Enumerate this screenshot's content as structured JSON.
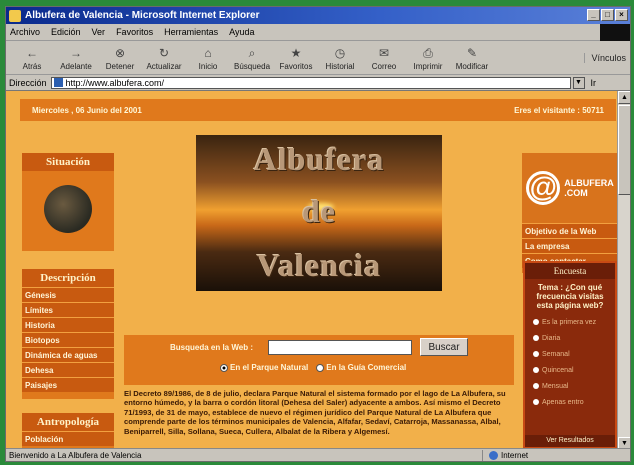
{
  "window": {
    "title": "Albufera de Valencia - Microsoft Internet Explorer",
    "buttons": [
      "_",
      "□",
      "×"
    ]
  },
  "menubar": [
    "Archivo",
    "Edición",
    "Ver",
    "Favoritos",
    "Herramientas",
    "Ayuda"
  ],
  "toolbar": {
    "items": [
      {
        "label": "Atrás",
        "icon": "back-arrow-icon",
        "glyph": "←"
      },
      {
        "label": "Adelante",
        "icon": "forward-arrow-icon",
        "glyph": "→"
      },
      {
        "label": "Detener",
        "icon": "stop-icon",
        "glyph": "⊗"
      },
      {
        "label": "Actualizar",
        "icon": "refresh-icon",
        "glyph": "↻"
      },
      {
        "label": "Inicio",
        "icon": "home-icon",
        "glyph": "⌂"
      },
      {
        "label": "Búsqueda",
        "icon": "search-icon",
        "glyph": "⌕"
      },
      {
        "label": "Favoritos",
        "icon": "favorites-icon",
        "glyph": "★"
      },
      {
        "label": "Historial",
        "icon": "history-icon",
        "glyph": "◷"
      },
      {
        "label": "Correo",
        "icon": "mail-icon",
        "glyph": "✉"
      },
      {
        "label": "Imprimir",
        "icon": "print-icon",
        "glyph": "⎙"
      },
      {
        "label": "Modificar",
        "icon": "edit-icon",
        "glyph": "✎"
      }
    ],
    "links_label": "Vínculos"
  },
  "address": {
    "label": "Dirección",
    "url": "http://www.albufera.com/",
    "go_label": "Ir"
  },
  "page": {
    "date": "Miercoles , 06 Junio del 2001",
    "visitor": "Eres el visitante : 50711",
    "banner_lines": [
      "Albufera",
      "de",
      "Valencia"
    ],
    "situacion_title": "Situación",
    "descripcion_title": "Descripción",
    "descripcion_items": [
      "Génesis",
      "Límites",
      "Historia",
      "Biotopos",
      "Dinámica de aguas",
      "Dehesa",
      "Paisajes"
    ],
    "antropologia_title": "Antropología",
    "antropologia_items": [
      "Población"
    ],
    "logo_text": [
      "ALBUFERA",
      ".COM"
    ],
    "logo_menu": [
      "Objetivo de la Web",
      "La empresa",
      "Como contactar"
    ],
    "search": {
      "label": "Busqueda en la Web :",
      "button": "Buscar",
      "options": [
        "En el Parque Natural",
        "En la Guía Comercial"
      ],
      "selected": 0
    },
    "body_text": "El Decreto 89/1986, de 8 de julio, declara Parque Natural el sistema formado por el lago de La Albufera, su entorno húmedo, y la barra o cordón litoral (Dehesa del Saler) adyacente a ambos. Así mismo el Decreto 71/1993, de 31 de mayo, establece de nuevo el régimen jurídico del Parque Natural de La Albufera que comprende parte de los términos municipales de Valencia, Alfafar, Sedaví, Catarroja, Massanassa, Albal, Beniparrell, Silla, Sollana, Sueca, Cullera, Albalat de la Ribera y Algemesí.",
    "poll": {
      "title": "Encuesta",
      "question": "Tema : ¿Con qué frecuencia visitas esta página web?",
      "options": [
        "Es la primera vez",
        "Diaria",
        "Semanal",
        "Quincenal",
        "Mensual",
        "Apenas entro"
      ],
      "results": "Ver Resultados"
    }
  },
  "status": {
    "text": "Bienvenido a La Albufera de Valencia",
    "zone": "Internet"
  },
  "colors": {
    "page_bg": "#f2b04a",
    "panel": "#e0791c",
    "panel_dark": "#c85a10",
    "poll_bg": "#8a2a0c"
  }
}
